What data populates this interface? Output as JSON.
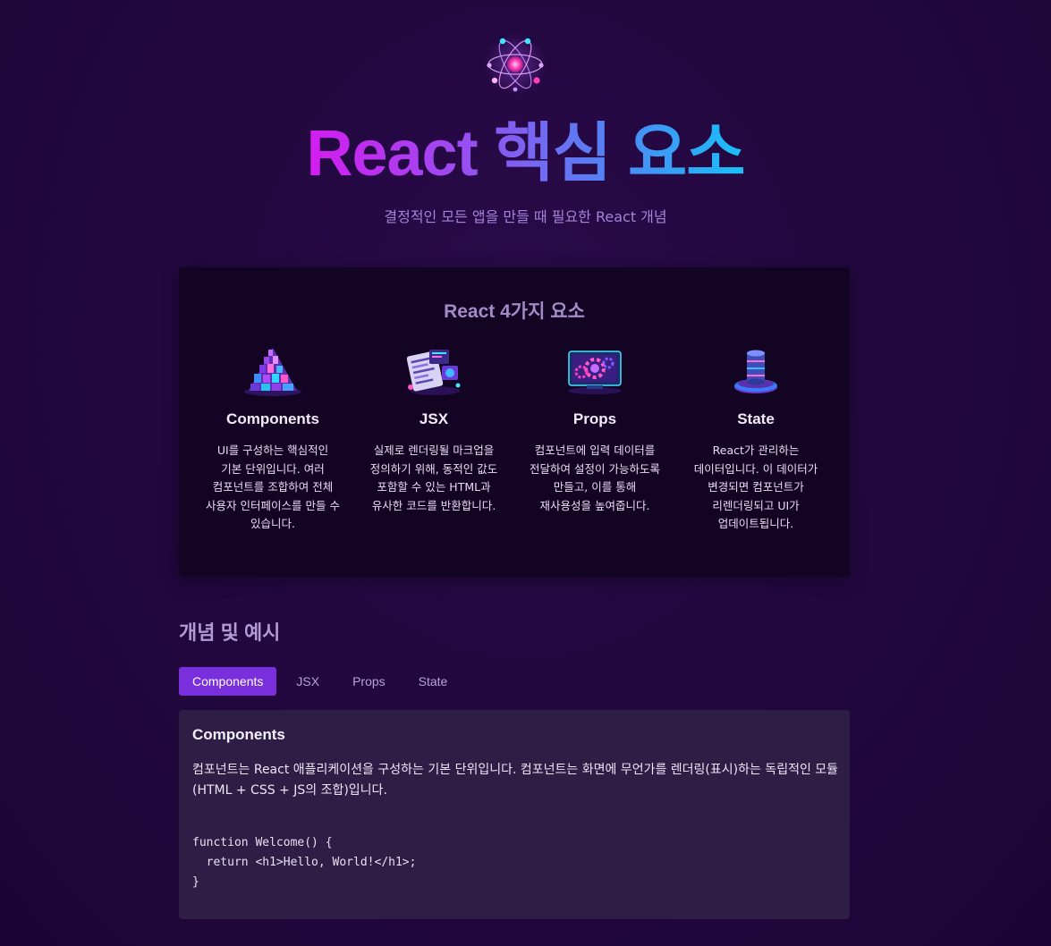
{
  "header": {
    "logo_icon": "atom-icon",
    "title": "React 핵심 요소",
    "subtitle": "결정적인 모든 앱을 만들 때 필요한 React 개념"
  },
  "overview": {
    "title": "React 4가지 요소",
    "items": [
      {
        "icon": "pyramid-blocks-icon",
        "name": "Components",
        "desc": "UI를 구성하는 핵심적인 기본 단위입니다. 여러 컴포넌트를 조합하여 전체 사용자 인터페이스를 만들 수 있습니다."
      },
      {
        "icon": "code-document-icon",
        "name": "JSX",
        "desc": "실제로 렌더링될 마크업을 정의하기 위해, 동적인 값도 포함할 수 있는 HTML과 유사한 코드를 반환합니다."
      },
      {
        "icon": "gears-monitor-icon",
        "name": "Props",
        "desc": "컴포넌트에 입력 데이터를 전달하여 설정이 가능하도록 만들고, 이를 통해 재사용성을 높여줍니다."
      },
      {
        "icon": "database-icon",
        "name": "State",
        "desc": "React가 관리하는 데이터입니다. 이 데이터가 변경되면 컴포넌트가 리렌더링되고 UI가 업데이트됩니다."
      }
    ]
  },
  "examples": {
    "section_title": "개념 및 예시",
    "tabs": [
      "Components",
      "JSX",
      "Props",
      "State"
    ],
    "active_tab": "Components",
    "content": {
      "title": "Components",
      "text": "컴포넌트는 React 애플리케이션을 구성하는 기본 단위입니다. 컴포넌트는 화면에 무언가를 렌더링(표시)하는 독립적인 모듈(HTML + CSS + JS의 조합)입니다.",
      "code": "function Welcome() {\n  return <h1>Hello, World!</h1>;\n}"
    }
  },
  "colors": {
    "accent": "#7a2fdc",
    "title_gradient_start": "#d41cf0",
    "title_gradient_end": "#18c0f8"
  }
}
